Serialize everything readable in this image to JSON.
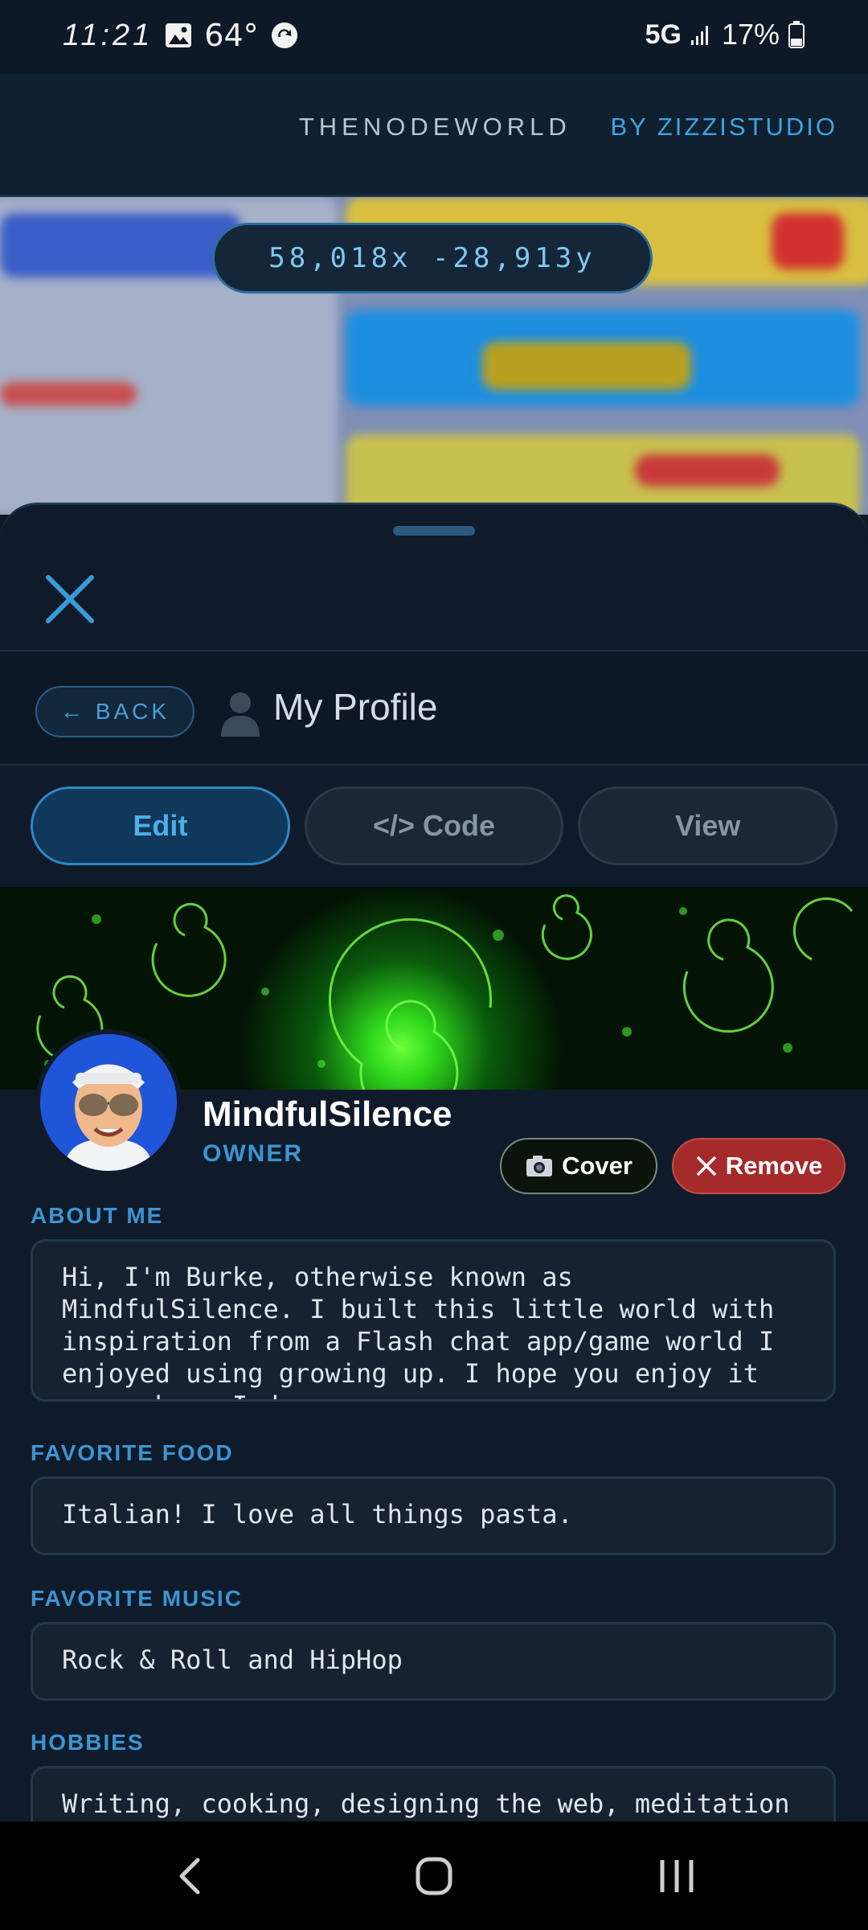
{
  "status_bar": {
    "time": "11:21",
    "temperature": "64°",
    "network": "5G",
    "battery": "17%"
  },
  "header": {
    "brand_primary": "THENODEWORLD",
    "brand_secondary": "BY ZIZZISTUDIO"
  },
  "map": {
    "coordinates": "58,018x -28,913y"
  },
  "profile": {
    "back_label": "← BACK",
    "title": "My Profile",
    "tabs": [
      {
        "label": "Edit",
        "active": true
      },
      {
        "label": "</> Code",
        "active": false
      },
      {
        "label": "View",
        "active": false
      }
    ],
    "cover_button": "Cover",
    "remove_button": "Remove",
    "username": "MindfulSilence",
    "role": "OWNER",
    "fields": [
      {
        "label": "ABOUT ME",
        "value": "Hi, I'm Burke, otherwise known as MindfulSilence. I built this little world with inspiration from a Flash chat app/game world I enjoyed using growing up. I hope you enjoy it as much as I do."
      },
      {
        "label": "FAVORITE FOOD",
        "value": "Italian! I love all things pasta."
      },
      {
        "label": "FAVORITE MUSIC",
        "value": "Rock & Roll and HipHop"
      },
      {
        "label": "HOBBIES",
        "value": "Writing, cooking, designing the web, meditation"
      }
    ]
  },
  "colors": {
    "accent": "#3c95d1",
    "remove": "#a52a2a",
    "background": "#0f1b2a"
  }
}
